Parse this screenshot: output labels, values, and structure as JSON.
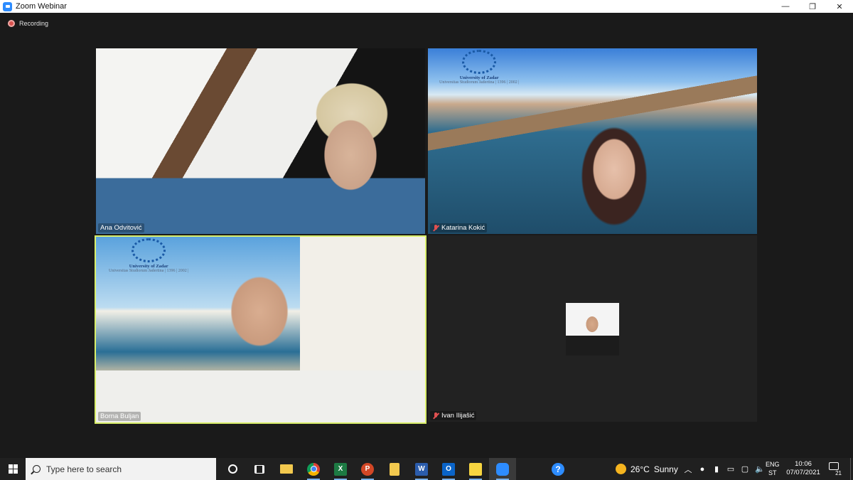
{
  "window": {
    "title": "Zoom Webinar",
    "controls": [
      "minimize",
      "restore",
      "close"
    ],
    "control_glyphs": [
      "—",
      "❐",
      "✕"
    ]
  },
  "recording": {
    "label": "Recording"
  },
  "participants": [
    {
      "name": "Ana Odvitović",
      "muted": false
    },
    {
      "name": "Katarina Kokić",
      "muted": true
    },
    {
      "name": "Borna Buljan",
      "muted": false,
      "active_speaker": true
    },
    {
      "name": "Ivan Ilijašić",
      "muted": true,
      "video_off": true
    }
  ],
  "virtual_background": {
    "university_name": "University of Zadar",
    "university_motto": "Universitas Studiorum Jadertina | 1396 | 2002 |"
  },
  "taskbar": {
    "search_placeholder": "Type here to search",
    "apps": [
      {
        "name": "task-view",
        "icon": "task-view-icon"
      },
      {
        "name": "file-explorer",
        "icon": "folder-icon"
      },
      {
        "name": "chrome",
        "icon": "chrome-icon"
      },
      {
        "name": "excel",
        "icon": "excel-icon",
        "glyph": "X"
      },
      {
        "name": "powerpoint",
        "icon": "powerpoint-icon",
        "glyph": "P"
      },
      {
        "name": "file",
        "icon": "file-icon"
      },
      {
        "name": "word",
        "icon": "word-icon",
        "glyph": "W"
      },
      {
        "name": "outlook",
        "icon": "outlook-icon",
        "glyph": "O"
      },
      {
        "name": "sticky-notes",
        "icon": "sticky-notes-icon"
      },
      {
        "name": "zoom",
        "icon": "zoom-icon",
        "active": true
      },
      {
        "name": "help",
        "icon": "help-icon",
        "glyph": "?"
      }
    ],
    "weather": {
      "temperature": "26°C",
      "condition": "Sunny"
    },
    "tray_icons": [
      "chevron-up-icon",
      "network-icon",
      "microphone-icon",
      "battery-icon",
      "display-icon",
      "volume-icon"
    ],
    "tray_glyphs": [
      "︿",
      "●",
      "▮",
      "▭",
      "▢",
      "🔈"
    ],
    "language": {
      "line1": "ENG",
      "line2": "ST"
    },
    "clock": {
      "time": "10:06",
      "date": "07/07/2021"
    },
    "notifications": {
      "count": "21"
    }
  },
  "colors": {
    "active_speaker_border": "#d9ef6a",
    "zoom_blue": "#2d8cff",
    "background": "#1a1a1a",
    "taskbar": "#202020"
  }
}
